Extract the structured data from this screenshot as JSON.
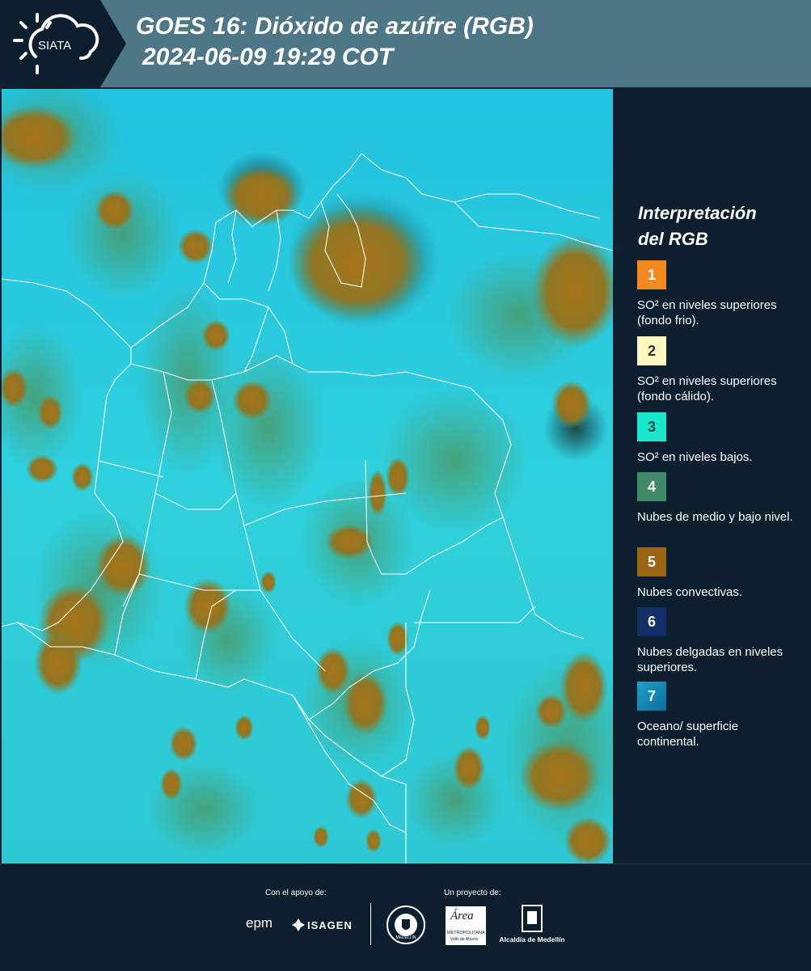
{
  "header": {
    "logo_text": "SIATA",
    "title_line1": "GOES 16: Dióxido de azúfre (RGB)",
    "title_line2": "2024-06-09 19:29 COT",
    "background": "#4d7787"
  },
  "legend": {
    "title_line1": "Interpretación",
    "title_line2": "del RGB",
    "items": [
      {
        "number": "1",
        "color": "#f28a1e",
        "text": "SO² en niveles superiores (fondo frio)."
      },
      {
        "number": "2",
        "color": "#fdf6c3",
        "text": "SO² en niveles superiores (fondo cálido)."
      },
      {
        "number": "3",
        "color": "#19e8cc",
        "text": "SO² en niveles bajos."
      },
      {
        "number": "4",
        "color": "#3e8a6a",
        "text": "Nubes de medio y bajo nivel."
      },
      {
        "number": "5",
        "color": "#9a6614",
        "text": "Nubes convectivas."
      },
      {
        "number": "6",
        "color": "#0f2f66",
        "text": "Nubes delgadas en niveles superiores."
      },
      {
        "number": "7",
        "color": "#1a8fc0",
        "text": "Oceano/ superficie continental."
      }
    ]
  },
  "footer": {
    "support_label": "Con el apoyo de:",
    "project_label": "Un proyecto de:",
    "sponsor_epm": "epm",
    "sponsor_isagen": "ISAGEN",
    "sponsor_area_line1": "Área",
    "sponsor_area_line2": "METROPOLITANA",
    "sponsor_area_line3": "Valle de Aburrá",
    "sponsor_alcaldia": "Alcaldía de Medellín",
    "seal_text": "MEDELLÍN"
  },
  "map": {
    "icons": [
      "satellite-map",
      "country-border-lines",
      "convective-clouds"
    ],
    "colors": {
      "background": "#27c9de",
      "clouds": "#a0781e",
      "low_clouds": "#4a9a6a",
      "borders": "#ffffff"
    }
  }
}
